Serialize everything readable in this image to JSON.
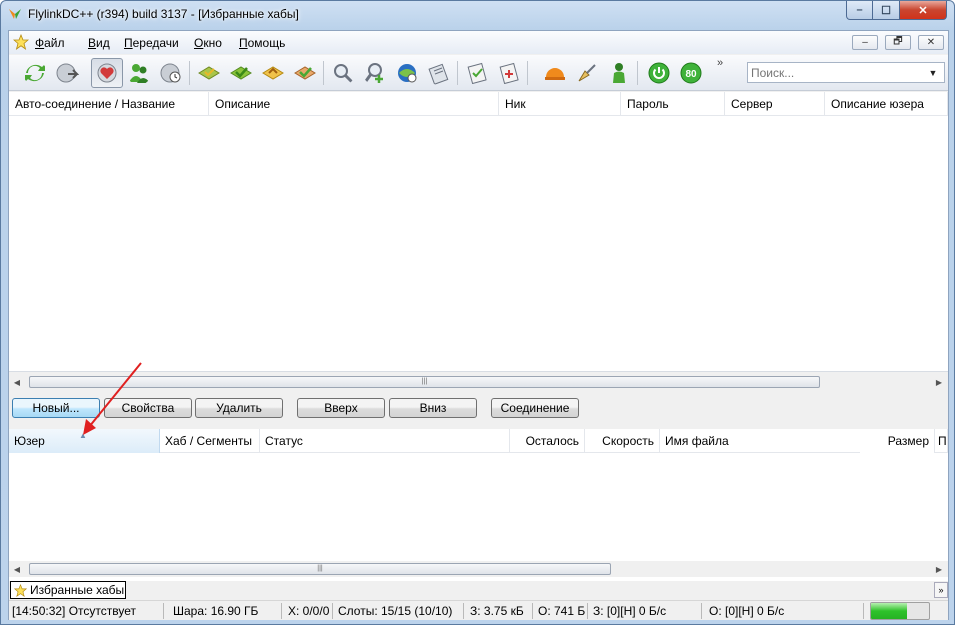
{
  "window": {
    "title": "FlylinkDC++ (r394) build 3137 - [Избранные хабы]",
    "controls": {
      "minimize": "–",
      "maximize": "☐",
      "close": "✕"
    }
  },
  "menu": {
    "items": [
      "Файл",
      "Вид",
      "Передачи",
      "Окно",
      "Помощь"
    ],
    "underlined": [
      "Ф",
      "В",
      "П",
      "О",
      "П"
    ],
    "rest": [
      "айл",
      "ид",
      "ередачи",
      "кно",
      "омощь"
    ],
    "mdi": {
      "minimize": "–",
      "restore": "🗗",
      "close": "✕"
    }
  },
  "toolbar": {
    "overflow": "»",
    "search_placeholder": "Поиск...",
    "colors": {
      "green": "#4aa834",
      "blue": "#2a6fc2",
      "orange": "#e6a020",
      "red": "#d23a3a"
    },
    "badge_text": "80"
  },
  "hubs_table": {
    "columns": [
      "Авто-соединение / Название",
      "Описание",
      "Ник",
      "Пароль",
      "Сервер",
      "Описание юзера"
    ],
    "rows": []
  },
  "actions": {
    "new": "Новый...",
    "properties": "Свойства",
    "delete": "Удалить",
    "up": "Вверх",
    "down": "Вниз",
    "connect": "Соединение"
  },
  "transfers_table": {
    "columns": [
      "Юзер",
      "Хаб / Сегменты",
      "Статус",
      "Осталось",
      "Скорость",
      "Имя файла",
      "Размер",
      "П"
    ],
    "rows": []
  },
  "tabs": [
    {
      "label": "Избранные хабы",
      "icon": "star-icon"
    }
  ],
  "statusbar": {
    "away": "[14:50:32] Отсутствует",
    "share": "Шара: 16.90 ГБ",
    "hubs": "Х: 0/0/0",
    "slots": "Слоты: 15/15 (10/10)",
    "downloaded": "З: 3.75 кБ",
    "uploaded": "О: 741 Б",
    "download_speed": "З: [0][Н] 0 Б/с",
    "upload_speed": "О: [0][Н] 0 Б/с",
    "progress_fraction": 0.62
  },
  "annotation": {
    "color": "#e02020"
  }
}
